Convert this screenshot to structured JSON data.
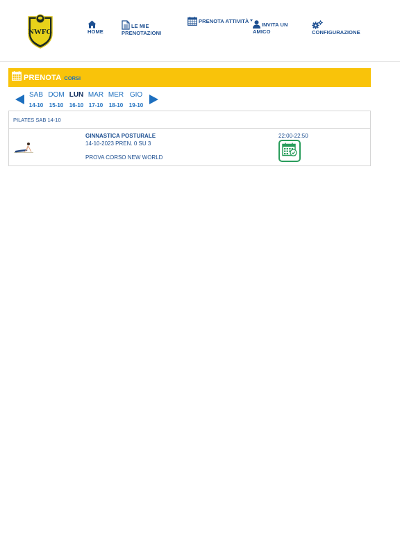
{
  "logo": {
    "text": "NWFG",
    "icon": "club-shield-logo"
  },
  "nav": {
    "home": {
      "label": "HOME",
      "icon": "home-icon"
    },
    "bookings": {
      "line1": "LE MIE",
      "line2": "PRENOTAZIONI",
      "icon": "document-icon"
    },
    "activities": {
      "label": "PRENOTA ATTIVITÀ",
      "icon": "calendar-icon"
    },
    "invite": {
      "line1": "INVITA UN",
      "line2": "AMICO",
      "icon": "user-icon"
    },
    "settings": {
      "label": "CONFIGURAZIONE",
      "icon": "gears-icon"
    }
  },
  "banner": {
    "title": "PRENOTA",
    "tag": "CORSI",
    "color": "#f9c30a"
  },
  "days": [
    {
      "name": "SAB",
      "date": "14-10"
    },
    {
      "name": "DOM",
      "date": "15-10"
    },
    {
      "name": "LUN",
      "date": "16-10"
    },
    {
      "name": "MAR",
      "date": "17-10"
    },
    {
      "name": "MER",
      "date": "18-10"
    },
    {
      "name": "GIO",
      "date": "19-10"
    }
  ],
  "active_day": "LUN",
  "panel": {
    "header": "PILATES SAB 14-10",
    "course": {
      "name": "GINNASTICA POSTURALE",
      "info": "14-10-2023 PREN. 0 SU 3",
      "note": "PROVA CORSO NEW WORLD",
      "time": "22:00-22:50",
      "thumb_icon": "pilates-pose-icon",
      "action_icon": "calendar-check-icon"
    }
  },
  "colors": {
    "primary": "#1d4f91",
    "accent": "#1d6fbf",
    "success": "#2a9d5c"
  }
}
